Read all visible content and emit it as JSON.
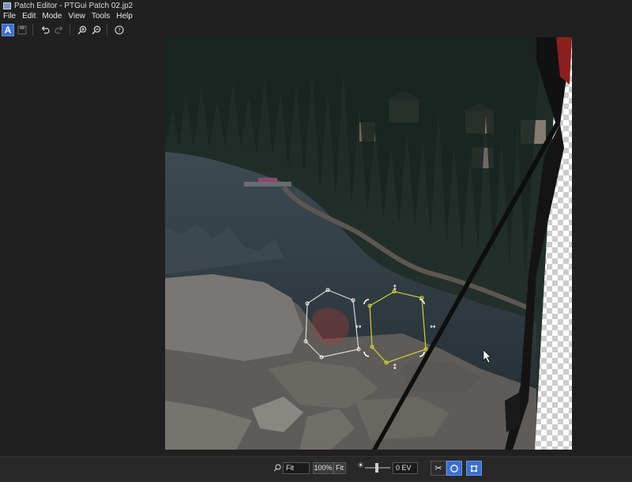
{
  "window": {
    "title": "Patch Editor - PTGui Patch 02.jp2"
  },
  "menu": {
    "items": [
      "File",
      "Edit",
      "Mode",
      "View",
      "Tools",
      "Help"
    ]
  },
  "bottom": {
    "zoom_value": "Fit",
    "zoom_100_label": "100%",
    "zoom_fit_label": "Fit",
    "exposure_value": "0 EV"
  },
  "colors": {
    "accent": "#3c6ecf",
    "patch_outline_white": "#d8d8d8",
    "patch_outline_yellow": "#cfd23a",
    "patch_red": "#d04040"
  }
}
